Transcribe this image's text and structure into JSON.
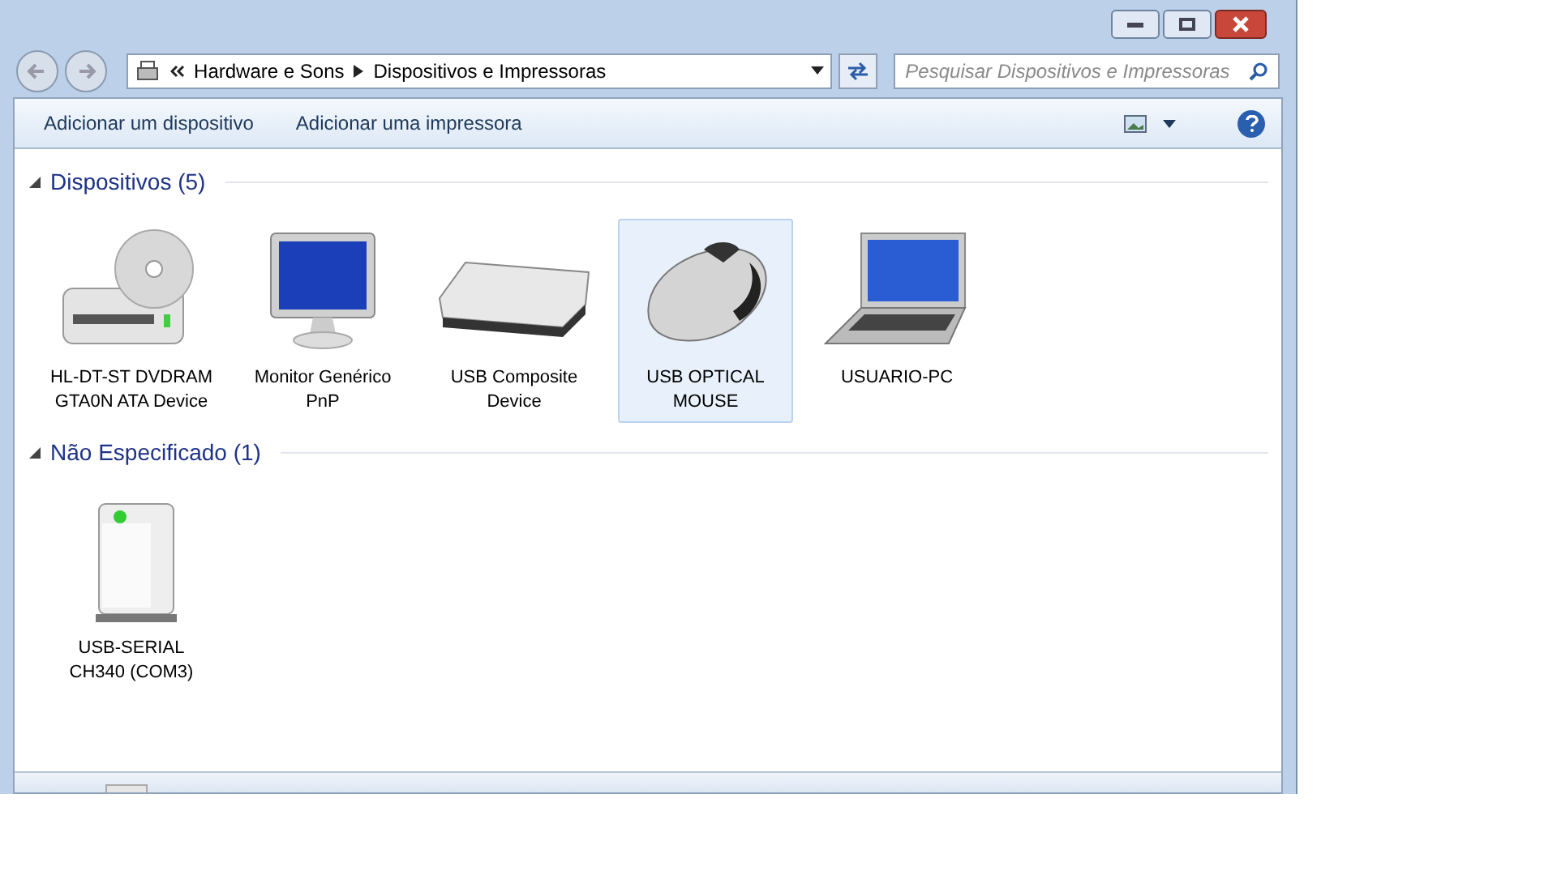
{
  "address": {
    "crumbs": [
      "Hardware e Sons",
      "Dispositivos e Impressoras"
    ]
  },
  "search": {
    "placeholder": "Pesquisar Dispositivos e Impressoras"
  },
  "toolbar": {
    "actions": [
      "Adicionar um dispositivo",
      "Adicionar uma impressora"
    ]
  },
  "groups": [
    {
      "title": "Dispositivos (5)",
      "expanded": true,
      "devices": [
        {
          "kind": "drive",
          "label": "HL-DT-ST DVDRAM GTA0N ATA Device",
          "selected": false
        },
        {
          "kind": "monitor",
          "label": "Monitor Genérico PnP",
          "selected": false
        },
        {
          "kind": "keyboard",
          "label": "USB Composite Device",
          "selected": false
        },
        {
          "kind": "mouse",
          "label": "USB OPTICAL MOUSE",
          "selected": true
        },
        {
          "kind": "laptop",
          "label": "USUARIO-PC",
          "selected": false
        }
      ]
    },
    {
      "title": "Não Especificado (1)",
      "expanded": true,
      "devices": [
        {
          "kind": "box",
          "label": "USB-SERIAL CH340 (COM3)",
          "selected": false
        }
      ]
    }
  ]
}
